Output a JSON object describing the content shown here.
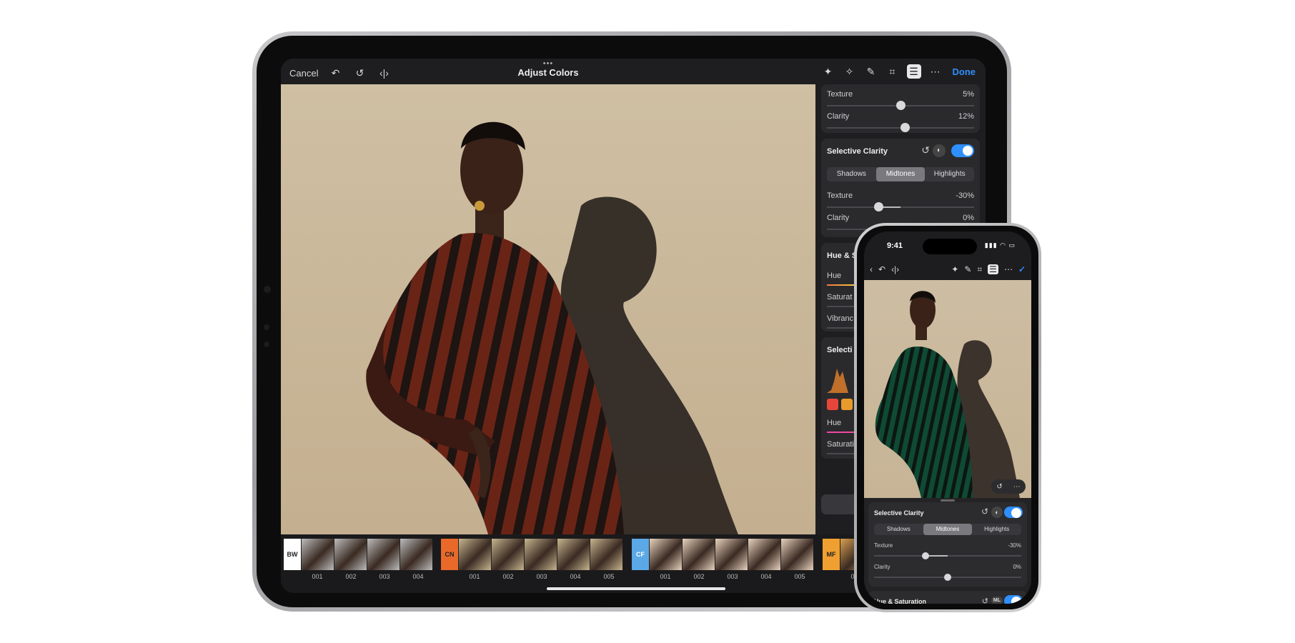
{
  "ipad": {
    "toolbar": {
      "cancel": "Cancel",
      "title": "Adjust Colors",
      "more_dots": "•••",
      "done": "Done",
      "left_icons": [
        "undo-icon",
        "revert-icon",
        "compare-icon"
      ],
      "right_icons": [
        "ml-wand-icon",
        "ml-super-icon",
        "retouch-icon",
        "crop-icon",
        "adjust-icon",
        "more-icon"
      ]
    },
    "panel": {
      "top_card": {
        "rows": [
          {
            "label": "Texture",
            "value": "5%",
            "knob": 0.5
          },
          {
            "label": "Clarity",
            "value": "12%",
            "knob": 0.53
          }
        ]
      },
      "selective_clarity": {
        "title": "Selective Clarity",
        "segments": [
          "Shadows",
          "Midtones",
          "Highlights"
        ],
        "selected": "Midtones",
        "rows": [
          {
            "label": "Texture",
            "value": "-30%",
            "knob": 0.35
          },
          {
            "label": "Clarity",
            "value": "0%",
            "knob": 0.5
          }
        ]
      },
      "hue_sat": {
        "title": "Hue & S",
        "rows": [
          "Hue",
          "Saturat",
          "Vibranc"
        ]
      },
      "selective_color": {
        "title": "Selecti",
        "rows": [
          "Hue",
          "Saturati"
        ]
      }
    },
    "filmstrip": [
      {
        "tag": "BW",
        "color": "#ffffff",
        "text": "#222222",
        "items": [
          "001",
          "002",
          "003",
          "004"
        ]
      },
      {
        "tag": "CN",
        "color": "#e8692a",
        "text": "#222222",
        "items": [
          "001",
          "002",
          "003",
          "004",
          "005"
        ]
      },
      {
        "tag": "CF",
        "color": "#5ba8e6",
        "text": "#ffffff",
        "items": [
          "001",
          "002",
          "003",
          "004",
          "005"
        ]
      },
      {
        "tag": "MF",
        "color": "#f0a030",
        "text": "#222222",
        "items": [
          "001"
        ]
      }
    ]
  },
  "iphone": {
    "time": "9:41",
    "status": "▮▮▮ ◠ ▭",
    "selective_clarity": {
      "title": "Selective Clarity",
      "segments": [
        "Shadows",
        "Midtones",
        "Highlights"
      ],
      "selected": "Midtones",
      "rows": [
        {
          "label": "Texture",
          "value": "-30%",
          "knob": 0.35
        },
        {
          "label": "Clarity",
          "value": "0%",
          "knob": 0.5
        }
      ]
    },
    "hue_sat_title": "Hue & Saturation",
    "ml_badge": "ML"
  },
  "colors": {
    "accent": "#2e8fff",
    "panel_bg": "#1e1e20",
    "card_bg": "#2a2a2d"
  }
}
